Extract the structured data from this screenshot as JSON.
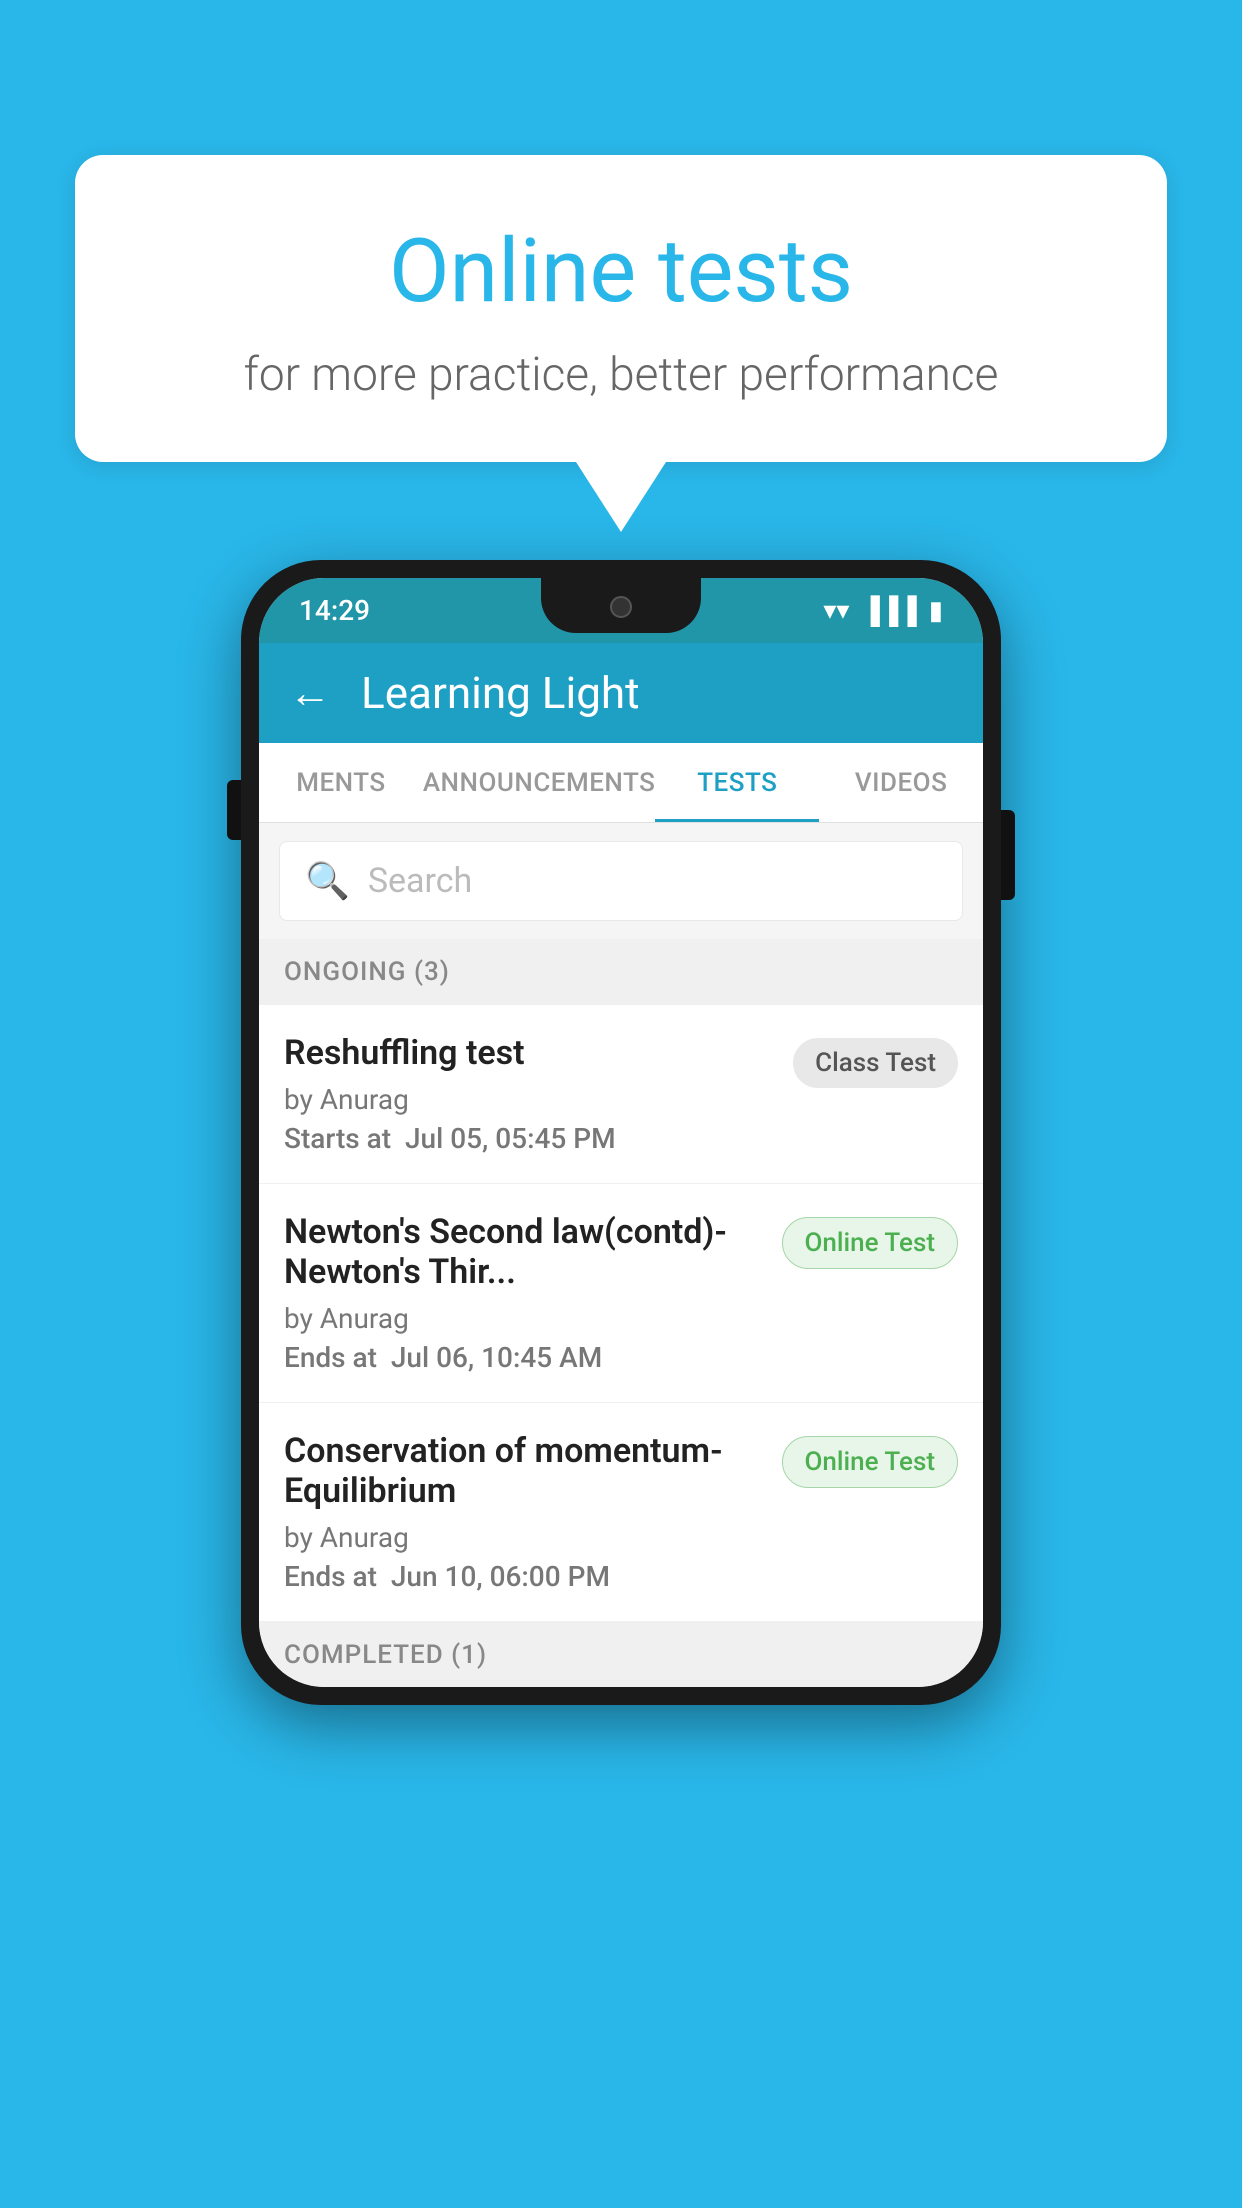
{
  "background_color": "#29b6e8",
  "bubble": {
    "title": "Online tests",
    "subtitle": "for more practice, better performance"
  },
  "status_bar": {
    "time": "14:29",
    "wifi_icon": "▼",
    "signal_icon": "▲",
    "battery_icon": "▐"
  },
  "app": {
    "title": "Learning Light",
    "back_label": "←"
  },
  "tabs": [
    {
      "label": "MENTS",
      "active": false
    },
    {
      "label": "ANNOUNCEMENTS",
      "active": false
    },
    {
      "label": "TESTS",
      "active": true
    },
    {
      "label": "VIDEOS",
      "active": false
    }
  ],
  "search": {
    "placeholder": "Search"
  },
  "section_ongoing": {
    "label": "ONGOING (3)"
  },
  "tests": [
    {
      "name": "Reshuffling test",
      "by": "by Anurag",
      "time_label": "Starts at",
      "time_value": "Jul 05, 05:45 PM",
      "badge": "Class Test",
      "badge_type": "class"
    },
    {
      "name": "Newton's Second law(contd)-Newton's Thir...",
      "by": "by Anurag",
      "time_label": "Ends at",
      "time_value": "Jul 06, 10:45 AM",
      "badge": "Online Test",
      "badge_type": "online"
    },
    {
      "name": "Conservation of momentum-Equilibrium",
      "by": "by Anurag",
      "time_label": "Ends at",
      "time_value": "Jun 10, 06:00 PM",
      "badge": "Online Test",
      "badge_type": "online"
    }
  ],
  "section_completed": {
    "label": "COMPLETED (1)"
  }
}
